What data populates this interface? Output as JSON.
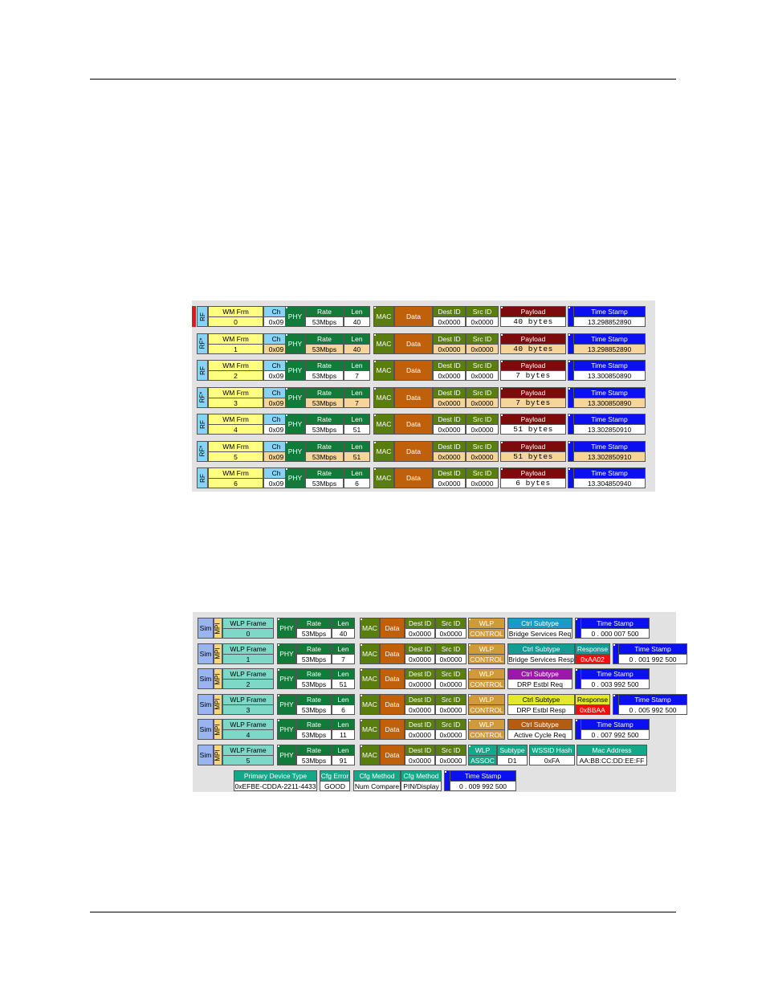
{
  "colors": {
    "yellow": "#ffff80",
    "lightblue": "#87d3f5",
    "phy_green": "#137b3a",
    "mac_olive": "#5a7d10",
    "data_orange": "#c0600a",
    "payload_maroon": "#7d0b0b",
    "timestamp_blue": "#0a10f0",
    "highlight": "#f5d59a",
    "sim_blue": "#9ab4f0",
    "wlp_teal": "#7ed8c8",
    "wlp_gold": "#d09a3a",
    "ctrl_blue": "#1a9ac8",
    "ctrl_teal": "#159a94",
    "ctrl_purple": "#9a1aa8",
    "ctrl_yellow": "#e4e82a",
    "ctrl_brown": "#b45c10",
    "response_red": "#f01010",
    "assoc_green": "#13a888",
    "error_red": "#e42020"
  },
  "figure1": {
    "headers": {
      "wm_frm": "WM Frm",
      "ch": "Ch",
      "phy": "PHY",
      "rate": "Rate",
      "len": "Len",
      "mac": "MAC",
      "data": "Data",
      "dest_id": "Dest ID",
      "src_id": "Src ID",
      "payload": "Payload",
      "time_stamp": "Time Stamp"
    },
    "rows": [
      {
        "tag": "RF",
        "frame": "0",
        "ch": "0x09",
        "rate": "53Mbps",
        "len": "40",
        "dest": "0x0000",
        "src": "0x0000",
        "payload": "40 bytes",
        "ts": "13.298852890",
        "retry": false,
        "error": true
      },
      {
        "tag": "RF*",
        "frame": "1",
        "ch": "0x09",
        "rate": "53Mbps",
        "len": "40",
        "dest": "0x0000",
        "src": "0x0000",
        "payload": "40 bytes",
        "ts": "13.298852890",
        "retry": true,
        "error": false
      },
      {
        "tag": "RF",
        "frame": "2",
        "ch": "0x09",
        "rate": "53Mbps",
        "len": "7",
        "dest": "0x0000",
        "src": "0x0000",
        "payload": "7 bytes",
        "ts": "13.300850890",
        "retry": false,
        "error": false
      },
      {
        "tag": "RF*",
        "frame": "3",
        "ch": "0x09",
        "rate": "53Mbps",
        "len": "7",
        "dest": "0x0000",
        "src": "0x0000",
        "payload": "7 bytes",
        "ts": "13.300850890",
        "retry": true,
        "error": false
      },
      {
        "tag": "RF",
        "frame": "4",
        "ch": "0x09",
        "rate": "53Mbps",
        "len": "51",
        "dest": "0x0000",
        "src": "0x0000",
        "payload": "51 bytes",
        "ts": "13.302850910",
        "retry": false,
        "error": false
      },
      {
        "tag": "RF*",
        "frame": "5",
        "ch": "0x09",
        "rate": "53Mbps",
        "len": "51",
        "dest": "0x0000",
        "src": "0x0000",
        "payload": "51 bytes",
        "ts": "13.302850910",
        "retry": true,
        "error": false
      },
      {
        "tag": "RF",
        "frame": "6",
        "ch": "0x09",
        "rate": "53Mbps",
        "len": "6",
        "dest": "0x0000",
        "src": "0x0000",
        "payload": "6 bytes",
        "ts": "13.304850940",
        "retry": false,
        "error": false
      }
    ]
  },
  "figure2": {
    "headers": {
      "sim": "Sim",
      "mpi": "MPI",
      "wlp_frame": "WLP Frame",
      "phy": "PHY",
      "rate": "Rate",
      "len": "Len",
      "mac": "MAC",
      "data": "Data",
      "dest_id": "Dest ID",
      "src_id": "Src ID",
      "wlp": "WLP",
      "ctrl_subtype": "Ctrl Subtype",
      "response": "Response",
      "time_stamp": "Time Stamp",
      "subtype": "Subtype",
      "wssid_hash": "WSSID Hash",
      "mac_address": "Mac Address",
      "primary_device_type": "Primary Device Type",
      "cfg_error": "Cfg Error",
      "cfg_method": "Cfg Method"
    },
    "rows": [
      {
        "frame": "0",
        "rate": "53Mbps",
        "len": "40",
        "dest": "0x0000",
        "src": "0x0000",
        "wlp": "CONTROL",
        "ctrl_subtype": "Bridge Services Req",
        "ctrl_color": "ctrl_blue",
        "ts": "0 . 000 007 500"
      },
      {
        "frame": "1",
        "rate": "53Mbps",
        "len": "7",
        "dest": "0x0000",
        "src": "0x0000",
        "wlp": "CONTROL",
        "ctrl_subtype": "Bridge Services Resp",
        "ctrl_color": "ctrl_teal",
        "response": "0xAA02",
        "ts": "0 . 001 992 500"
      },
      {
        "frame": "2",
        "rate": "53Mbps",
        "len": "51",
        "dest": "0x0000",
        "src": "0x0000",
        "wlp": "CONTROL",
        "ctrl_subtype": "DRP Estbl Req",
        "ctrl_color": "ctrl_purple",
        "ts": "0 . 003 992 500"
      },
      {
        "frame": "3",
        "rate": "53Mbps",
        "len": "6",
        "dest": "0x0000",
        "src": "0x0000",
        "wlp": "CONTROL",
        "ctrl_subtype": "DRP Estbl Resp",
        "ctrl_color": "ctrl_yellow",
        "response": "0xBBAA",
        "ts": "0 . 005 992 500"
      },
      {
        "frame": "4",
        "rate": "53Mbps",
        "len": "11",
        "dest": "0x0000",
        "src": "0x0000",
        "wlp": "CONTROL",
        "ctrl_subtype": "Active Cycle Req",
        "ctrl_color": "ctrl_brown",
        "ts": "0 . 007 992 500"
      },
      {
        "frame": "5",
        "rate": "53Mbps",
        "len": "91",
        "dest": "0x0000",
        "src": "0x0000",
        "wlp": "ASSOC",
        "subtype": "D1",
        "wssid_hash": "0xFA",
        "mac_address": "AA:BB:CC:DD:EE:FF",
        "primary_device_type": "0xEFBE-CDDA-2211-4433",
        "cfg_error": "GOOD",
        "cfg_method_1": "Num Compare",
        "cfg_method_2": "PIN/Display",
        "ts": "0 . 009 992 500"
      }
    ]
  }
}
